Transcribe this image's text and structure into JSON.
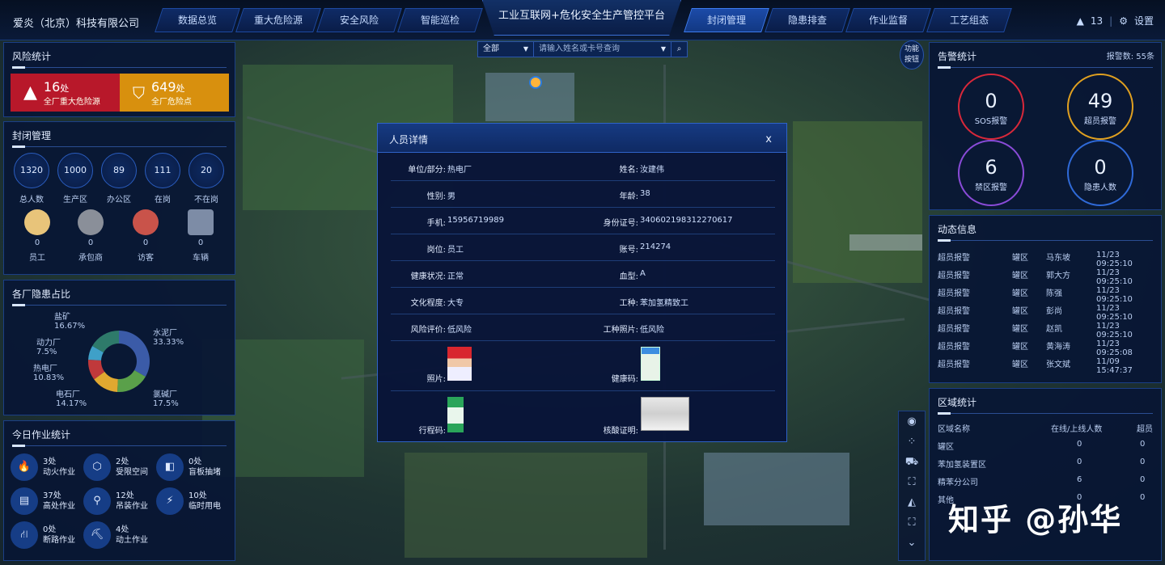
{
  "header": {
    "company": "爱炎（北京）科技有限公司",
    "center_title": "工业互联网+危化安全生产管控平台",
    "nav_left": [
      "数据总览",
      "重大危险源",
      "安全风险",
      "智能巡检"
    ],
    "nav_right": [
      "封闭管理",
      "隐患排查",
      "作业监督",
      "工艺组态"
    ],
    "active_nav": "封闭管理",
    "alert_count": "13",
    "settings_label": "设置"
  },
  "risk": {
    "title": "风险统计",
    "major_num": "16",
    "major_unit": "处",
    "major_label": "全厂重大危险源",
    "general_num": "649",
    "general_unit": "处",
    "general_label": "全厂危险点"
  },
  "closed": {
    "title": "封闭管理",
    "stats": [
      {
        "value": "1320",
        "label": "总人数"
      },
      {
        "value": "1000",
        "label": "生产区"
      },
      {
        "value": "89",
        "label": "办公区"
      },
      {
        "value": "111",
        "label": "在岗"
      },
      {
        "value": "20",
        "label": "不在岗"
      }
    ],
    "people": [
      {
        "value": "0",
        "label": "员工",
        "icon": "worker-icon"
      },
      {
        "value": "0",
        "label": "承包商",
        "icon": "contractor-icon"
      },
      {
        "value": "0",
        "label": "访客",
        "icon": "visitor-icon"
      },
      {
        "value": "0",
        "label": "车辆",
        "icon": "vehicle-icon"
      }
    ]
  },
  "hazard": {
    "title": "各厂隐患占比",
    "segments": [
      {
        "name": "水泥厂",
        "pct": "33.33%",
        "value": 33.33,
        "color": "#3b5ba8"
      },
      {
        "name": "氯碱厂",
        "pct": "17.5%",
        "value": 17.5,
        "color": "#5aa04a"
      },
      {
        "name": "电石厂",
        "pct": "14.17%",
        "value": 14.17,
        "color": "#e0a830"
      },
      {
        "name": "热电厂",
        "pct": "10.83%",
        "value": 10.83,
        "color": "#c0393b"
      },
      {
        "name": "动力厂",
        "pct": "7.5%",
        "value": 7.5,
        "color": "#3fa0c8"
      },
      {
        "name": "盐矿",
        "pct": "16.67%",
        "value": 16.67,
        "color": "#2e7a6a"
      }
    ]
  },
  "work": {
    "title": "今日作业统计",
    "items": [
      {
        "count": "3处",
        "label": "动火作业",
        "icon": "fire-icon",
        "glyph": "🔥"
      },
      {
        "count": "2处",
        "label": "受限空间",
        "icon": "box-icon",
        "glyph": "⬡"
      },
      {
        "count": "0处",
        "label": "盲板抽堵",
        "icon": "valve-icon",
        "glyph": "◧"
      },
      {
        "count": "37处",
        "label": "高处作业",
        "icon": "height-icon",
        "glyph": "▤"
      },
      {
        "count": "12处",
        "label": "吊装作业",
        "icon": "hook-icon",
        "glyph": "⚲"
      },
      {
        "count": "10处",
        "label": "临时用电",
        "icon": "bolt-icon",
        "glyph": "⚡"
      },
      {
        "count": "0处",
        "label": "断路作业",
        "icon": "road-icon",
        "glyph": "⛙"
      },
      {
        "count": "4处",
        "label": "动土作业",
        "icon": "dig-icon",
        "glyph": "⛏"
      }
    ]
  },
  "search": {
    "scope": "全部",
    "placeholder": "请输入姓名或卡号查询"
  },
  "func_btn": "功能\n按钮",
  "modal": {
    "title": "人员详情",
    "close": "x",
    "rows": [
      {
        "k1": "单位/部分:",
        "v1": "热电厂",
        "k2": "姓名:",
        "v2": "汝建伟"
      },
      {
        "k1": "性别:",
        "v1": "男",
        "k2": "年龄:",
        "v2": "38"
      },
      {
        "k1": "手机:",
        "v1": "15956719989",
        "k2": "身份证号:",
        "v2": "340602198312270617"
      },
      {
        "k1": "岗位:",
        "v1": "员工",
        "k2": "账号:",
        "v2": "214274"
      },
      {
        "k1": "健康状况:",
        "v1": "正常",
        "k2": "血型:",
        "v2": "A"
      },
      {
        "k1": "文化程度:",
        "v1": "大专",
        "k2": "工种:",
        "v2": "苯加氢精致工"
      },
      {
        "k1": "风险评价:",
        "v1": "低风险",
        "k2": "工种照片:",
        "v2": "低风险"
      }
    ],
    "photo_label": "照片:",
    "health_code_label": "健康码:",
    "trip_code_label": "行程码:",
    "nucleic_label": "核酸证明:"
  },
  "alerts": {
    "title": "告警统计",
    "count_label": "报警数: 55条",
    "rings": [
      {
        "n": "0",
        "t": "SOS报警",
        "color": "#d8283a"
      },
      {
        "n": "49",
        "t": "超员报警",
        "color": "#e0a020"
      },
      {
        "n": "6",
        "t": "禁区报警",
        "color": "#8a4bd8"
      },
      {
        "n": "0",
        "t": "隐患人数",
        "color": "#2f6ad8"
      }
    ]
  },
  "dynamic": {
    "title": "动态信息",
    "rows": [
      {
        "type": "超员报警",
        "area": "罐区",
        "name": "马东坡",
        "time": "11/23 09:25:10"
      },
      {
        "type": "超员报警",
        "area": "罐区",
        "name": "郭大方",
        "time": "11/23 09:25:10"
      },
      {
        "type": "超员报警",
        "area": "罐区",
        "name": "陈强",
        "time": "11/23 09:25:10"
      },
      {
        "type": "超员报警",
        "area": "罐区",
        "name": "彭尚",
        "time": "11/23 09:25:10"
      },
      {
        "type": "超员报警",
        "area": "罐区",
        "name": "赵凯",
        "time": "11/23 09:25:10"
      },
      {
        "type": "超员报警",
        "area": "罐区",
        "name": "黄海涛",
        "time": "11/23 09:25:08"
      },
      {
        "type": "超员报警",
        "area": "罐区",
        "name": "张文斌",
        "time": "11/09 15:47:37"
      }
    ]
  },
  "area": {
    "title": "区域统计",
    "headers": [
      "区域名称",
      "在线/上线人数",
      "超员"
    ],
    "rows": [
      {
        "name": "罐区",
        "online": "0",
        "over": "0"
      },
      {
        "name": "苯加氢装置区",
        "online": "0",
        "over": "0"
      },
      {
        "name": "精苯分公司",
        "online": "6",
        "over": "0"
      },
      {
        "name": "其他",
        "online": "0",
        "over": "0"
      }
    ]
  },
  "watermark": "知乎 @孙华"
}
